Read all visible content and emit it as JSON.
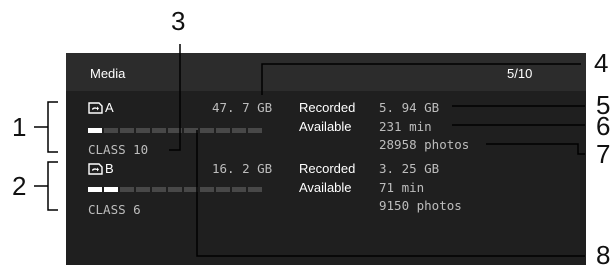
{
  "screen": {
    "title": "Media",
    "page_indicator": "5/10",
    "colors": {
      "background": "#1f1f1f",
      "header": "#2c2c2c",
      "text": "#ffffff",
      "value_text": "#bdbdbd",
      "bar_used": "#ffffff",
      "bar_empty": "#484848"
    }
  },
  "memory_a": {
    "icon": "sd-card-icon",
    "name": "A",
    "capacity": "47. 7 GB",
    "speed_class": "CLASS 10",
    "usage_segments_filled": 1,
    "usage_segments_total": 11,
    "recorded_label": "Recorded",
    "recorded_value": "5. 94 GB",
    "available_label": "Available",
    "available_time": "231 min",
    "available_photos": "28958 photos"
  },
  "memory_b": {
    "icon": "sd-card-icon",
    "name": "B",
    "capacity": "16. 2 GB",
    "speed_class": "CLASS 6",
    "usage_segments_filled": 2,
    "usage_segments_total": 11,
    "recorded_label": "Recorded",
    "recorded_value": "3. 25 GB",
    "available_label": "Available",
    "available_time": "71 min",
    "available_photos": "9150 photos"
  },
  "callouts": [
    "1",
    "2",
    "3",
    "4",
    "5",
    "6",
    "7",
    "8"
  ]
}
